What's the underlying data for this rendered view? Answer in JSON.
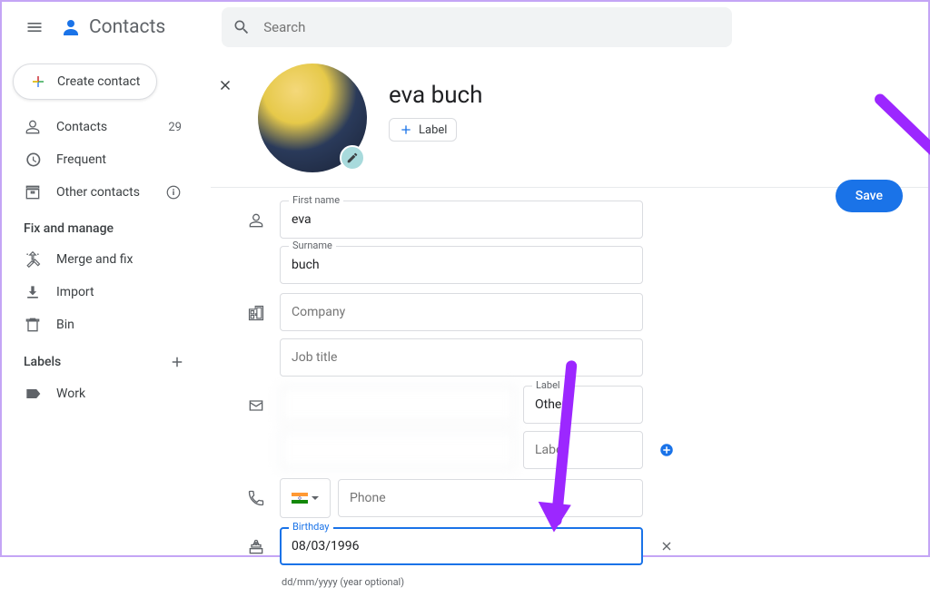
{
  "header": {
    "app_name": "Contacts",
    "search_placeholder": "Search"
  },
  "sidebar": {
    "create_label": "Create contact",
    "nav": [
      {
        "icon": "person",
        "label": "Contacts",
        "count": "29"
      },
      {
        "icon": "history",
        "label": "Frequent"
      },
      {
        "icon": "archive",
        "label": "Other contacts",
        "info": true
      }
    ],
    "fix_manage_header": "Fix and manage",
    "fix_manage": [
      {
        "icon": "merge",
        "label": "Merge and fix"
      },
      {
        "icon": "download",
        "label": "Import"
      },
      {
        "icon": "trash",
        "label": "Bin"
      }
    ],
    "labels_header": "Labels",
    "labels": [
      {
        "icon": "label",
        "label": "Work"
      }
    ]
  },
  "contact": {
    "display_name": "eva buch",
    "label_chip": "Label",
    "save": "Save",
    "fields": {
      "first_name_label": "First name",
      "first_name": "eva",
      "surname_label": "Surname",
      "surname": "buch",
      "company_placeholder": "Company",
      "job_title_placeholder": "Job title",
      "email1_value": "",
      "email1_label_label": "Label",
      "email1_label_value": "Other",
      "email2_value": "",
      "email2_label_placeholder": "Label",
      "phone_placeholder": "Phone",
      "birthday_label": "Birthday",
      "birthday_value": "08/03/1996",
      "birthday_helper": "dd/mm/yyyy (year optional)"
    }
  }
}
